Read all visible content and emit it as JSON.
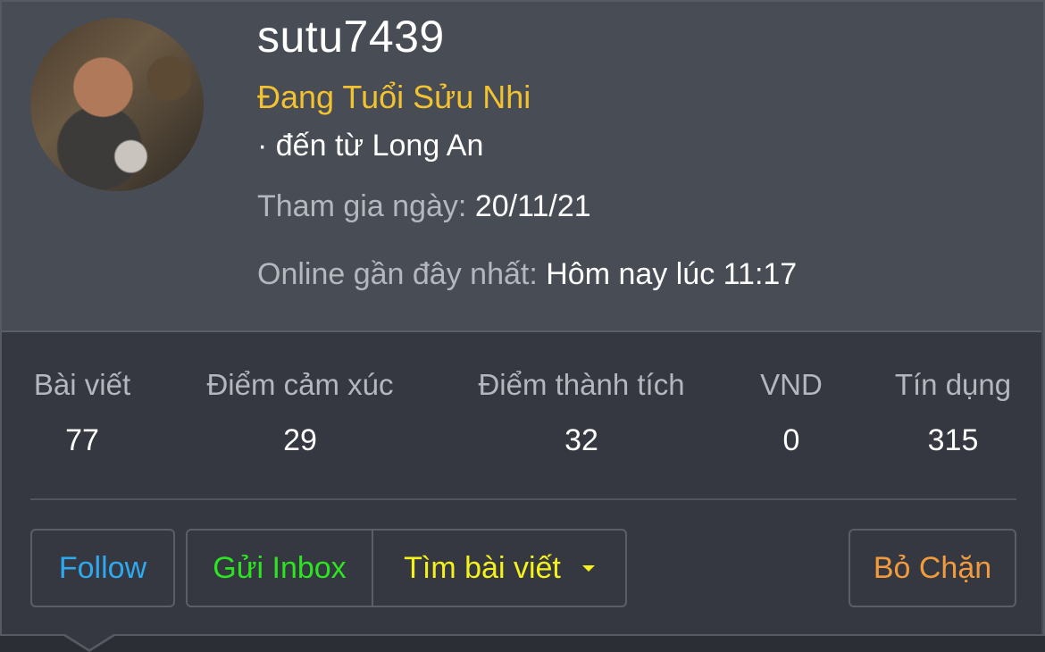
{
  "profile": {
    "username": "sutu7439",
    "title": "Đang Tuổi Sửu Nhi",
    "location": "· đến từ Long An",
    "joined_label": "Tham gia ngày:",
    "joined_value": "20/11/21",
    "online_label": "Online gần đây nhất:",
    "online_value": "Hôm nay lúc 11:17",
    "avatar_icon": "user-avatar"
  },
  "stats": [
    {
      "label": "Bài viết",
      "value": "77"
    },
    {
      "label": "Điểm cảm xúc",
      "value": "29"
    },
    {
      "label": "Điểm thành tích",
      "value": "32"
    },
    {
      "label": "VND",
      "value": "0"
    },
    {
      "label": "Tín dụng",
      "value": "315"
    }
  ],
  "actions": {
    "follow": "Follow",
    "inbox": "Gửi Inbox",
    "search_posts": "Tìm bài viết",
    "unblock": "Bỏ Chặn"
  },
  "colors": {
    "title": "#f2c230",
    "follow": "#2ea9ef",
    "inbox": "#2be61f",
    "search": "#f4f21a",
    "unblock": "#f39a3c"
  }
}
